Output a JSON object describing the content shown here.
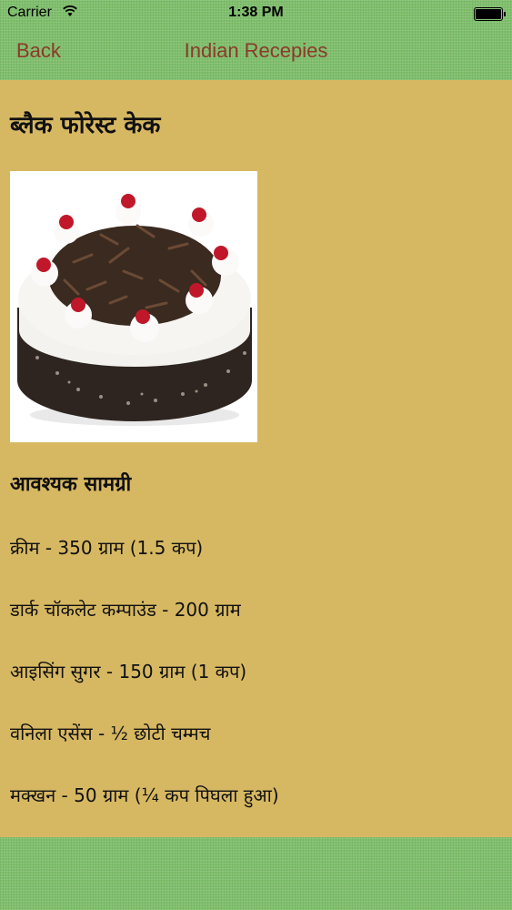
{
  "status_bar": {
    "carrier": "Carrier",
    "time": "1:38 PM"
  },
  "nav": {
    "back_label": "Back",
    "title": "Indian Recepies"
  },
  "recipe": {
    "title": "ब्लैक फोरेस्ट केक",
    "image_icon": "black-forest-cake-photo",
    "ingredients_heading": "आवश्यक सामग्री",
    "ingredients": [
      "क्रीम - 350 ग्राम (1.5 कप)",
      "डार्क चॉकलेट कम्पाउंड - 200 ग्राम",
      "आइसिंग सुगर - 150 ग्राम (1 कप)",
      "वनिला एसेंस - ½ छोटी चम्मच",
      "मक्खन - 50 ग्राम (¼ कप पिघला हुआ)"
    ]
  },
  "colors": {
    "nav_green": "#7fbf6c",
    "content_bg": "#d7b862",
    "nav_text": "#8b3a2a"
  }
}
